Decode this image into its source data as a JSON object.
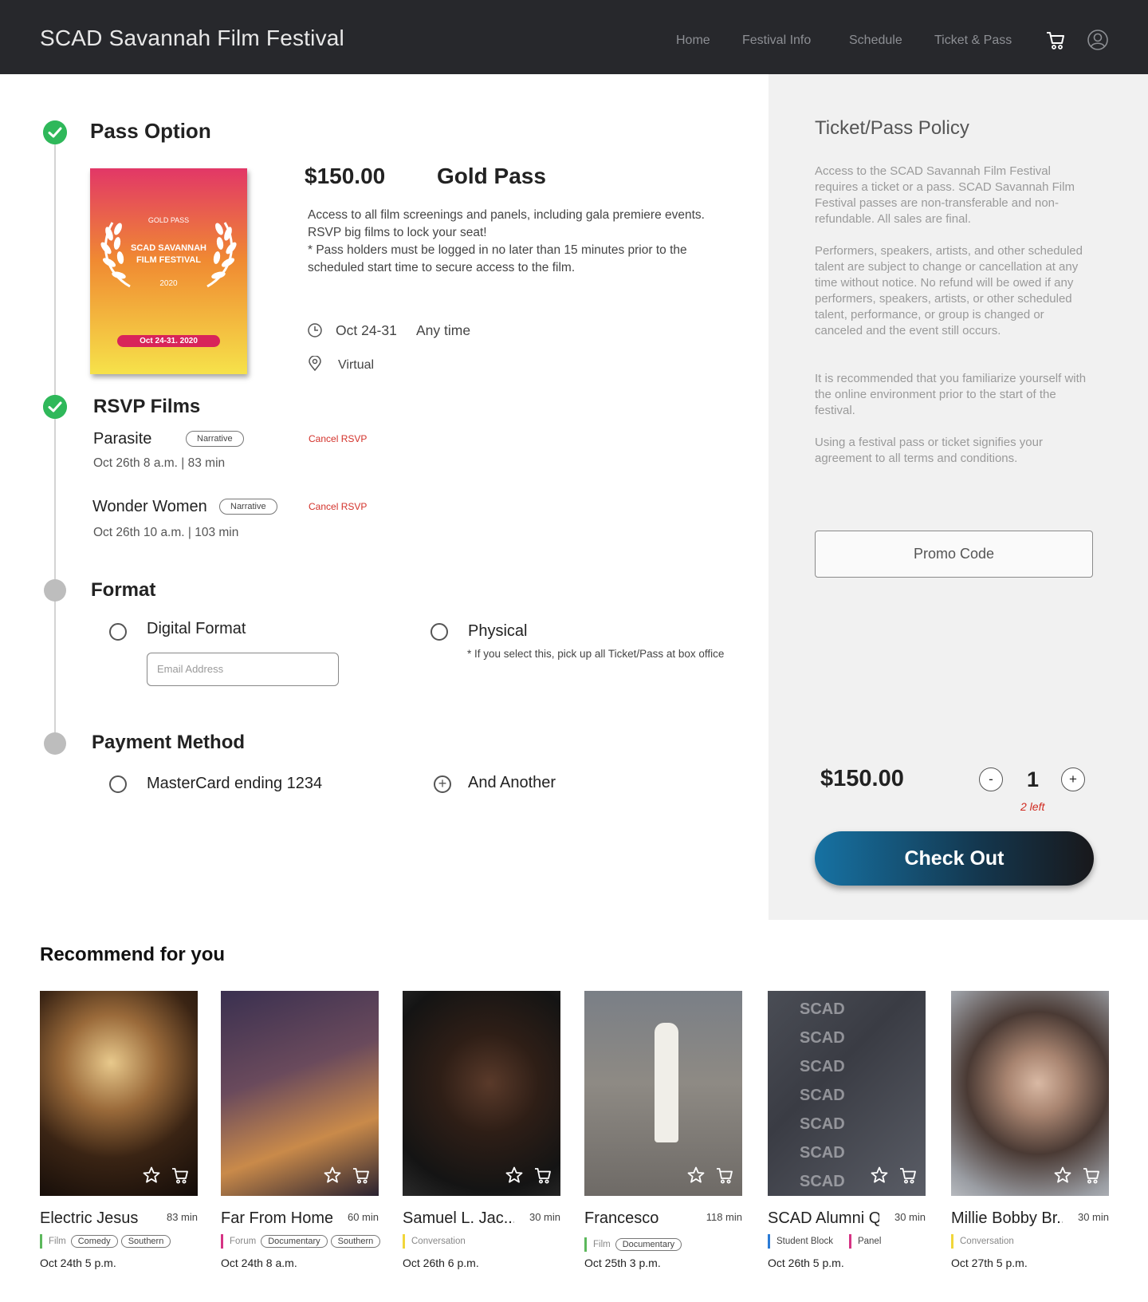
{
  "header": {
    "brand": "SCAD Savannah Film Festival",
    "nav": [
      "Home",
      "Festival Info",
      "Schedule",
      "Ticket & Pass"
    ]
  },
  "pass_option": {
    "title": "Pass Option",
    "poster": {
      "label": "GOLD PASS",
      "name_line1": "SCAD SAVANNAH",
      "name_line2": "FILM FESTIVAL",
      "year": "2020",
      "dates": "Oct 24-31. 2020"
    },
    "price": "$150.00",
    "name": "Gold Pass",
    "description": "Access to all film screenings and panels, including gala premiere events. RSVP big films to lock your seat!",
    "note": "* Pass holders must be logged in no later than 15 minutes prior to the scheduled start time to secure access to the film.",
    "dates": "Oct 24-31",
    "time": "Any time",
    "location": "Virtual"
  },
  "rsvp": {
    "title": "RSVP Films",
    "films": [
      {
        "title": "Parasite",
        "tag": "Narrative",
        "meta": "Oct 26th 8 a.m. | 83 min",
        "action": "Cancel RSVP"
      },
      {
        "title": "Wonder Women",
        "tag": "Narrative",
        "meta": "Oct 26th 10 a.m. | 103 min",
        "action": "Cancel RSVP"
      }
    ]
  },
  "format": {
    "title": "Format",
    "digital": "Digital Format",
    "email_placeholder": "Email Address",
    "physical": "Physical",
    "physical_note": "* If you select this, pick up all Ticket/Pass at box office"
  },
  "payment": {
    "title": "Payment Method",
    "card": "MasterCard ending 1234",
    "another": "And Another"
  },
  "policy": {
    "title": "Ticket/Pass Policy",
    "paragraphs": [
      "Access to the SCAD Savannah Film Festival requires a ticket or a pass. SCAD Savannah Film Festival passes are non-transferable and non-refundable. All sales are final.",
      "Performers, speakers, artists, and other scheduled talent are subject to change or cancellation at any time without notice. No refund will be owed if any performers, speakers, artists, or other scheduled talent, performance, or group is changed or canceled and the event still occurs.",
      "It is recommended that you familiarize yourself with the online environment prior to the start of the festival.",
      "Using a festival pass or ticket signifies your agreement to all terms and conditions."
    ],
    "promo": "Promo Code"
  },
  "order": {
    "total": "$150.00",
    "minus": "-",
    "qty": "1",
    "plus": "+",
    "left": "2 left",
    "checkout": "Check Out"
  },
  "recommend": {
    "title": "Recommend for you",
    "cards": [
      {
        "name": "Electric Jesus",
        "duration": "83 min",
        "category": "Film",
        "category_color": "#5cb85c",
        "tags": [
          "Comedy",
          "Southern"
        ],
        "date": "Oct 24th 5 p.m."
      },
      {
        "name": "Far From Home",
        "duration": "60 min",
        "category": "Forum",
        "category_color": "#d63384",
        "tags": [
          "Documentary",
          "Southern"
        ],
        "date": "Oct 24th 8 a.m."
      },
      {
        "name": "Samuel L. Jac...",
        "duration": "30 min",
        "category": "Conversation",
        "category_color": "#f1d63a",
        "tags": [],
        "date": "Oct 26th 6 p.m."
      },
      {
        "name": "Francesco",
        "duration": "118 min",
        "category": "Film",
        "category_color": "#5cb85c",
        "tags": [
          "Documentary"
        ],
        "date": "Oct 25th 3 p.m."
      },
      {
        "name": "SCAD Alumni Q..",
        "duration": "30 min",
        "category": "Student Block",
        "category_color": "#2b7bd6",
        "category2": "Panel",
        "category2_color": "#d63384",
        "tags": [],
        "date": "Oct 26th 5 p.m."
      },
      {
        "name": "Millie Bobby Br...",
        "duration": "30 min",
        "category": "Conversation",
        "category_color": "#f1d63a",
        "tags": [],
        "date": "Oct 27th 5 p.m."
      }
    ]
  }
}
